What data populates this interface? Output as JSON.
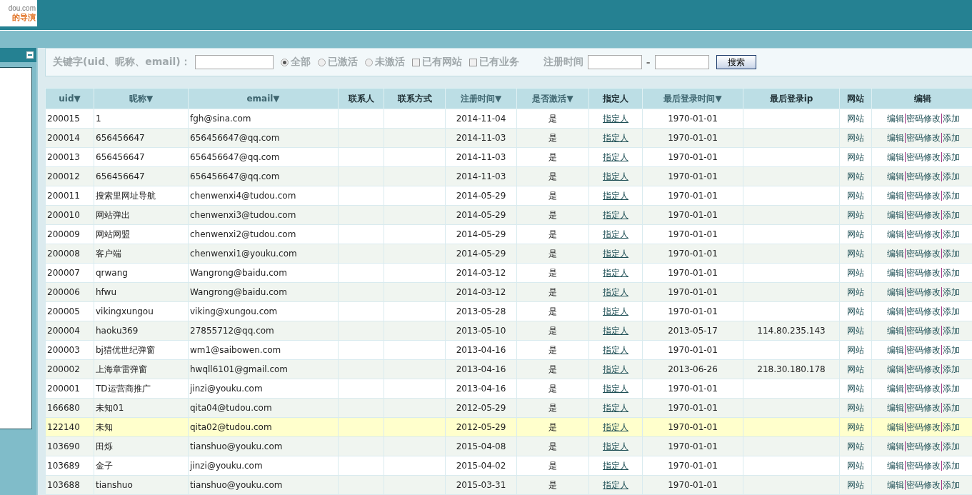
{
  "logo": {
    "domain": "dou.com",
    "slogan": "的导演"
  },
  "filter": {
    "keyword_label": "关键字(uid、昵称、email)：",
    "status_options": [
      {
        "label": "全部",
        "selected": true
      },
      {
        "label": "已激活",
        "selected": false
      },
      {
        "label": "未激活",
        "selected": false
      }
    ],
    "checks": [
      {
        "label": "已有网站",
        "checked": false
      },
      {
        "label": "已有业务",
        "checked": false
      }
    ],
    "date_label": "注册时间",
    "date_separator": "-",
    "search_button": "搜索"
  },
  "table": {
    "columns": [
      {
        "label": "uid▼",
        "kind": "sort"
      },
      {
        "label": "昵称▼",
        "kind": "sort"
      },
      {
        "label": "email▼",
        "kind": "sort"
      },
      {
        "label": "联系人",
        "kind": "plain"
      },
      {
        "label": "联系方式",
        "kind": "plain"
      },
      {
        "label": "注册时间▼",
        "kind": "sort"
      },
      {
        "label": "是否激活▼",
        "kind": "sort"
      },
      {
        "label": "指定人",
        "kind": "plain"
      },
      {
        "label": "最后登录时间▼",
        "kind": "sort"
      },
      {
        "label": "最后登录ip",
        "kind": "plain"
      },
      {
        "label": "网站",
        "kind": "plain"
      },
      {
        "label": "编辑",
        "kind": "plain"
      }
    ],
    "rows": [
      {
        "uid": "200015",
        "nickname": "1",
        "email": "fgh@sina.com",
        "registered": "2014-11-04",
        "active": "是",
        "assign": "指定人",
        "last_login": "1970-01-01",
        "site": "网站",
        "actions": [
          "编辑",
          "密码修改",
          "添加"
        ],
        "selected": false
      },
      {
        "uid": "200014",
        "nickname": "656456647",
        "email": "656456647@qq.com",
        "registered": "2014-11-03",
        "active": "是",
        "assign": "指定人",
        "last_login": "1970-01-01",
        "site": "网站",
        "actions": [
          "编辑",
          "密码修改",
          "添加"
        ],
        "selected": false
      },
      {
        "uid": "200013",
        "nickname": "656456647",
        "email": "656456647@qq.com",
        "registered": "2014-11-03",
        "active": "是",
        "assign": "指定人",
        "last_login": "1970-01-01",
        "site": "网站",
        "actions": [
          "编辑",
          "密码修改",
          "添加"
        ],
        "selected": false
      },
      {
        "uid": "200012",
        "nickname": "656456647",
        "email": "656456647@qq.com",
        "registered": "2014-11-03",
        "active": "是",
        "assign": "指定人",
        "last_login": "1970-01-01",
        "site": "网站",
        "actions": [
          "编辑",
          "密码修改",
          "添加"
        ],
        "selected": false
      },
      {
        "uid": "200011",
        "nickname": "搜索里网址导航",
        "email": "chenwenxi4@tudou.com",
        "registered": "2014-05-29",
        "active": "是",
        "assign": "指定人",
        "last_login": "1970-01-01",
        "site": "网站",
        "actions": [
          "编辑",
          "密码修改",
          "添加"
        ],
        "selected": false
      },
      {
        "uid": "200010",
        "nickname": "网站弹出",
        "email": "chenwenxi3@tudou.com",
        "registered": "2014-05-29",
        "active": "是",
        "assign": "指定人",
        "last_login": "1970-01-01",
        "site": "网站",
        "actions": [
          "编辑",
          "密码修改",
          "添加"
        ],
        "selected": false
      },
      {
        "uid": "200009",
        "nickname": "网站网盟",
        "email": "chenwenxi2@tudou.com",
        "registered": "2014-05-29",
        "active": "是",
        "assign": "指定人",
        "last_login": "1970-01-01",
        "site": "网站",
        "actions": [
          "编辑",
          "密码修改",
          "添加"
        ],
        "selected": false
      },
      {
        "uid": "200008",
        "nickname": "客户端",
        "email": "chenwenxi1@youku.com",
        "registered": "2014-05-29",
        "active": "是",
        "assign": "指定人",
        "last_login": "1970-01-01",
        "site": "网站",
        "actions": [
          "编辑",
          "密码修改",
          "添加"
        ],
        "selected": false
      },
      {
        "uid": "200007",
        "nickname": "qrwang",
        "email": "Wangrong@baidu.com",
        "registered": "2014-03-12",
        "active": "是",
        "assign": "指定人",
        "last_login": "1970-01-01",
        "site": "网站",
        "actions": [
          "编辑",
          "密码修改",
          "添加"
        ],
        "selected": false
      },
      {
        "uid": "200006",
        "nickname": "hfwu",
        "email": "Wangrong@baidu.com",
        "registered": "2014-03-12",
        "active": "是",
        "assign": "指定人",
        "last_login": "1970-01-01",
        "site": "网站",
        "actions": [
          "编辑",
          "密码修改",
          "添加"
        ],
        "selected": false
      },
      {
        "uid": "200005",
        "nickname": "vikingxungou",
        "email": "viking@xungou.com",
        "registered": "2013-05-28",
        "active": "是",
        "assign": "指定人",
        "last_login": "1970-01-01",
        "site": "网站",
        "actions": [
          "编辑",
          "密码修改",
          "添加"
        ],
        "selected": false
      },
      {
        "uid": "200004",
        "nickname": "haoku369",
        "email": "27855712@qq.com",
        "registered": "2013-05-10",
        "active": "是",
        "assign": "指定人",
        "last_login": "2013-05-17",
        "ip": "114.80.235.143",
        "site": "网站",
        "actions": [
          "编辑",
          "密码修改",
          "添加"
        ],
        "selected": false
      },
      {
        "uid": "200003",
        "nickname": "bj猎优世纪弹窗",
        "email": "wm1@saibowen.com",
        "registered": "2013-04-16",
        "active": "是",
        "assign": "指定人",
        "last_login": "1970-01-01",
        "site": "网站",
        "actions": [
          "编辑",
          "密码修改",
          "添加"
        ],
        "selected": false
      },
      {
        "uid": "200002",
        "nickname": "上海章雷弹窗",
        "email": "hwqll6101@gmail.com",
        "registered": "2013-04-16",
        "active": "是",
        "assign": "指定人",
        "last_login": "2013-06-26",
        "ip": "218.30.180.178",
        "site": "网站",
        "actions": [
          "编辑",
          "密码修改",
          "添加"
        ],
        "selected": false
      },
      {
        "uid": "200001",
        "nickname": "TD运营商推广",
        "email": "jinzi@youku.com",
        "registered": "2013-04-16",
        "active": "是",
        "assign": "指定人",
        "last_login": "1970-01-01",
        "site": "网站",
        "actions": [
          "编辑",
          "密码修改",
          "添加"
        ],
        "selected": false
      },
      {
        "uid": "166680",
        "nickname": "未知01",
        "email": "qita04@tudou.com",
        "registered": "2012-05-29",
        "active": "是",
        "assign": "指定人",
        "last_login": "1970-01-01",
        "site": "网站",
        "actions": [
          "编辑",
          "密码修改",
          "添加"
        ],
        "selected": false
      },
      {
        "uid": "122140",
        "nickname": "未知",
        "email": "qita02@tudou.com",
        "registered": "2012-05-29",
        "active": "是",
        "assign": "指定人",
        "last_login": "1970-01-01",
        "site": "网站",
        "actions": [
          "编辑",
          "密码修改",
          "添加"
        ],
        "selected": true
      },
      {
        "uid": "103690",
        "nickname": "田烁",
        "email": "tianshuo@youku.com",
        "registered": "2015-04-08",
        "active": "是",
        "assign": "指定人",
        "last_login": "1970-01-01",
        "site": "网站",
        "actions": [
          "编辑",
          "密码修改",
          "添加"
        ],
        "selected": false
      },
      {
        "uid": "103689",
        "nickname": "金子",
        "email": "jinzi@youku.com",
        "registered": "2015-04-02",
        "active": "是",
        "assign": "指定人",
        "last_login": "1970-01-01",
        "site": "网站",
        "actions": [
          "编辑",
          "密码修改",
          "添加"
        ],
        "selected": false
      },
      {
        "uid": "103688",
        "nickname": "tianshuo",
        "email": "tianshuo@youku.com",
        "registered": "2015-03-31",
        "active": "是",
        "assign": "指定人",
        "last_login": "1970-01-01",
        "site": "网站",
        "actions": [
          "编辑",
          "密码修改",
          "添加"
        ],
        "selected": false
      }
    ]
  }
}
